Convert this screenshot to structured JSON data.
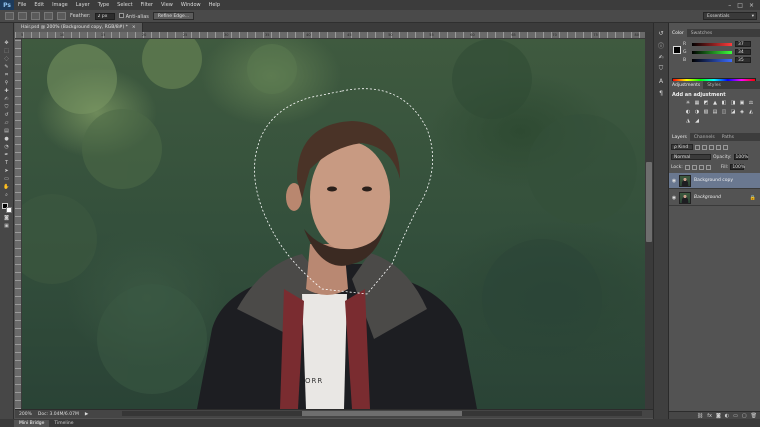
{
  "app": {
    "logo": "Ps"
  },
  "menu": [
    "File",
    "Edit",
    "Image",
    "Layer",
    "Type",
    "Select",
    "Filter",
    "View",
    "Window",
    "Help"
  ],
  "window_controls": [
    "–",
    "□",
    "×"
  ],
  "options": {
    "feather_label": "Feather:",
    "feather_value": "2 px",
    "antialias_label": "Anti-alias",
    "refine_label": "Refine Edge...",
    "workspace": "Essentials"
  },
  "document": {
    "tab_title": "Hair.psd @ 200% (Background copy, RGB/8#) *",
    "close": "×",
    "ruler_marks": [
      "5",
      "10",
      "15",
      "20",
      "25",
      "30",
      "35",
      "40",
      "45",
      "50",
      "55",
      "60",
      "65",
      "70",
      "75",
      "80"
    ],
    "zoom": "200%",
    "doc_size": "Doc: 3.04M/6.07M",
    "status_arrow": "▶",
    "canvas_text": "ORR"
  },
  "bottom_tabs": [
    "Mini Bridge",
    "Timeline"
  ],
  "color_panel": {
    "tabs": [
      "Color",
      "Swatches"
    ],
    "channels": [
      {
        "name": "R",
        "value": "37",
        "gradient": "#ff3b3b"
      },
      {
        "name": "G",
        "value": "34",
        "gradient": "#3bff3b"
      },
      {
        "name": "B",
        "value": "35",
        "gradient": "#3b6bff"
      }
    ]
  },
  "adjustments_panel": {
    "tabs": [
      "Adjustments",
      "Styles"
    ],
    "title": "Add an adjustment",
    "icons_row1": [
      "☀",
      "▦",
      "◩",
      "▲",
      "◧",
      "◨"
    ],
    "icons_row2": [
      "▣",
      "⚖",
      "◐",
      "◑",
      "▧",
      "▤"
    ],
    "icons_row3": [
      "◫",
      "◪",
      "◈",
      "◭",
      "◮",
      "◢"
    ]
  },
  "layers_panel": {
    "tabs": [
      "Layers",
      "Channels",
      "Paths"
    ],
    "kind_filter": "ρ Kind",
    "blend_mode": "Normal",
    "opacity_label": "Opacity:",
    "opacity_value": "100%",
    "lock_label": "Lock:",
    "fill_label": "Fill:",
    "fill_value": "100%",
    "layers": [
      {
        "name": "Background copy",
        "selected": true
      },
      {
        "name": "Background",
        "selected": false
      }
    ],
    "eye_glyph": "◉",
    "lock_glyph": "🔒",
    "footer_icons": [
      "⛓",
      "fx",
      "◙",
      "◐",
      "▭",
      "▢",
      "🗑"
    ]
  },
  "colors": {
    "accent_selected_layer": "#6a7890",
    "canvas_foliage": "#3f5a3f"
  }
}
